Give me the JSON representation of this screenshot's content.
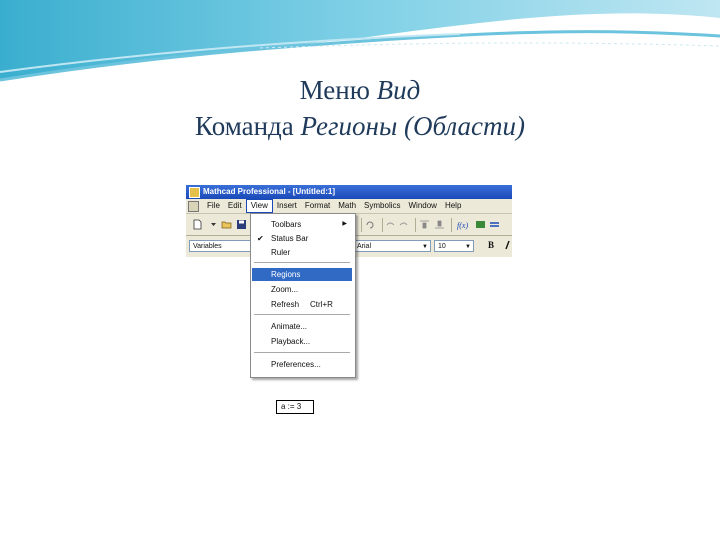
{
  "slide": {
    "title_line1": "Меню",
    "title_line1_italic": "Вид",
    "title_line2": "Команда",
    "title_line2_italic": "Регионы (Области)"
  },
  "window": {
    "title": "Mathcad Professional - [Untitled:1]"
  },
  "menubar": {
    "items": [
      "File",
      "Edit",
      "View",
      "Insert",
      "Format",
      "Math",
      "Symbolics",
      "Window",
      "Help"
    ],
    "active": "View"
  },
  "format_bar": {
    "style_value": "Variables",
    "font_value": "Arial",
    "size_value": "10",
    "bold_label": "B"
  },
  "view_menu": {
    "items": [
      {
        "label": "Toolbars",
        "submenu": true
      },
      {
        "label": "Status Bar",
        "checked": true
      },
      {
        "label": "Ruler"
      },
      {
        "label": "Regions",
        "highlighted": true
      },
      {
        "label": "Zoom..."
      },
      {
        "label": "Refresh",
        "shortcut": "Ctrl+R"
      },
      {
        "label": "Animate..."
      },
      {
        "label": "Playback..."
      },
      {
        "label": "Preferences..."
      }
    ]
  },
  "worksheet": {
    "region_text": "a := 3"
  },
  "colors": {
    "title_text": "#1f3a5a",
    "wave_dark": "#29a3c6",
    "wave_light": "#bfe6f2",
    "menu_highlight": "#316ac5"
  }
}
